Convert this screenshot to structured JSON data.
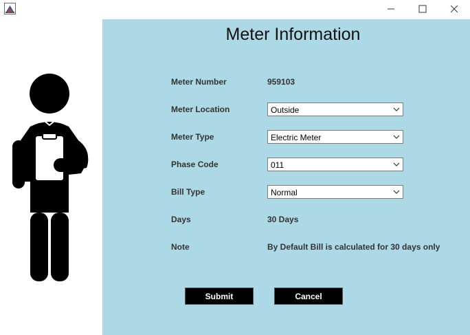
{
  "window": {
    "app_icon": "java-app-icon",
    "controls": [
      "minimize-icon",
      "maximize-icon",
      "close-icon"
    ]
  },
  "form": {
    "title": "Meter Information",
    "fields": {
      "meter_number": {
        "label": "Meter Number",
        "value": "959103"
      },
      "meter_location": {
        "label": "Meter Location",
        "selected": "Outside"
      },
      "meter_type": {
        "label": "Meter Type",
        "selected": "Electric Meter"
      },
      "phase_code": {
        "label": "Phase Code",
        "selected": "011"
      },
      "bill_type": {
        "label": "Bill Type",
        "selected": "Normal"
      },
      "days": {
        "label": "Days",
        "value": "30 Days"
      },
      "note": {
        "label": "Note",
        "value": "By Default Bill is calculated for 30 days only"
      }
    },
    "buttons": {
      "submit": "Submit",
      "cancel": "Cancel"
    }
  },
  "illustration": "person-with-clipboard-icon",
  "colors": {
    "panel_bg": "#add8e6",
    "button_bg": "#000000",
    "button_text": "#ffffff"
  }
}
